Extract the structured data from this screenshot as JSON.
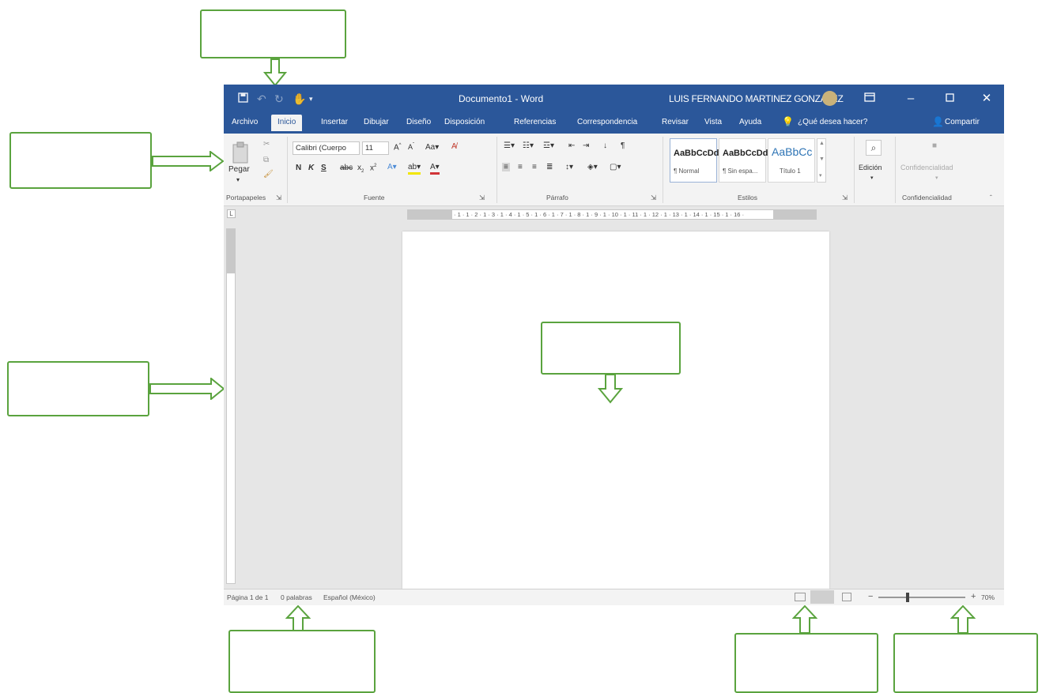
{
  "colors": {
    "ribbon_blue": "#2b579a",
    "callout_green": "#5aa33e",
    "page_white": "#ffffff",
    "canvas_gray": "#e6e6e6"
  },
  "title_bar": {
    "document_title": "Documento1 - Word",
    "user_name": "LUIS FERNANDO MARTINEZ GONZALEZ",
    "icons": [
      "save-icon",
      "undo-icon",
      "redo-icon",
      "touch-mode-icon",
      "customize-qat-icon",
      "avatar",
      "ribbon-display-icon",
      "minimize-icon",
      "maximize-icon",
      "close-icon"
    ]
  },
  "tabs": [
    "Archivo",
    "Inicio",
    "Insertar",
    "Dibujar",
    "Diseño",
    "Disposición",
    "Referencias",
    "Correspondencia",
    "Revisar",
    "Vista",
    "Ayuda"
  ],
  "active_tab": "Inicio",
  "tell_me": "¿Qué desea hacer?",
  "share_label": "Compartir",
  "ribbon": {
    "clipboard": {
      "paste_label": "Pegar",
      "group_label": "Portapapeles"
    },
    "font": {
      "font_name": "Calibri (Cuerpo",
      "font_size": "11",
      "bold": "N",
      "italic": "K",
      "underline": "S",
      "change_case": "Aa",
      "group_label": "Fuente"
    },
    "paragraph": {
      "group_label": "Párrafo"
    },
    "styles": {
      "items": [
        {
          "sample": "AaBbCcDd",
          "name": "¶ Normal"
        },
        {
          "sample": "AaBbCcDd",
          "name": "¶ Sin espa..."
        },
        {
          "sample": "AaBbCc",
          "name": "Título 1"
        }
      ],
      "group_label": "Estilos"
    },
    "editing": {
      "label": "Edición"
    },
    "confidentiality": {
      "label": "Confidencialidad",
      "group_label": "Confidencialidad"
    }
  },
  "ruler": {
    "text": "· 1 · 1 · 2 · 1 · 3 · 1 · 4 · 1 · 5 · 1 · 6 · 1 · 7 · 1 · 8 · 1 · 9 · 1 · 10 · 1 · 11 · 1 · 12 · 1 · 13 · 1 · 14 · 1 · 15 · 1 · 16 ·"
  },
  "status": {
    "page": "Página 1 de 1",
    "words": "0 palabras",
    "language": "Español (México)",
    "zoom": "70%",
    "zoom_level_percent": 70
  }
}
